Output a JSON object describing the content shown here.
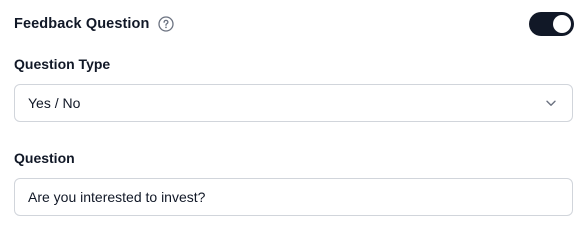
{
  "header": {
    "title": "Feedback Question",
    "help_icon": "help-circle-icon",
    "toggle_on": true
  },
  "question_type": {
    "label": "Question Type",
    "selected": "Yes / No",
    "icon": "chevron-down-icon"
  },
  "question": {
    "label": "Question",
    "value": "Are you interested to invest?"
  },
  "colors": {
    "toggle_on": "#111827",
    "border": "#d1d5db",
    "text": "#111827",
    "icon_gray": "#6b7280"
  }
}
